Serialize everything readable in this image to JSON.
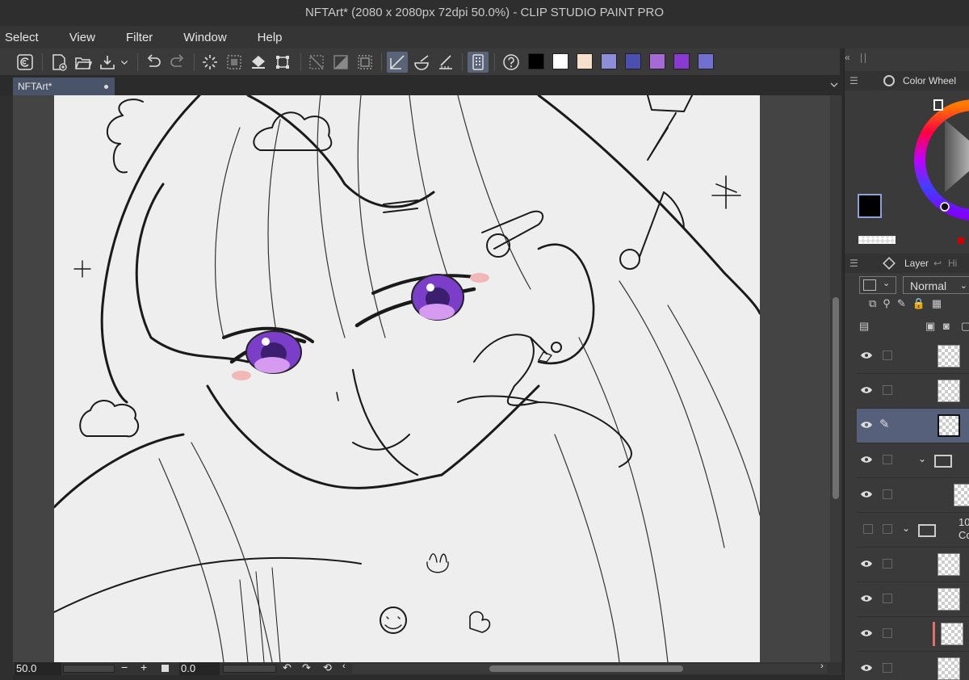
{
  "window": {
    "title": "NFTArt* (2080 x 2080px 72dpi 50.0%)  - CLIP STUDIO PAINT PRO"
  },
  "menu": [
    "Select",
    "View",
    "Filter",
    "Window",
    "Help"
  ],
  "document_tab": {
    "label": "NFTArt*"
  },
  "palette_colors": [
    "#000000",
    "#ffffff",
    "#f6e0cc",
    "#8c8fd8",
    "#4b4fb0",
    "#a66ad8",
    "#8a3ad0",
    "#7070d0"
  ],
  "color_panel": {
    "title": "Color Wheel",
    "main_color": "#000000",
    "sub_color": "#3c3a36"
  },
  "layer_panel": {
    "tab_label": "Layer",
    "tab2_label": "Hi",
    "blend_mode": "Normal",
    "group_label_1": "10",
    "group_label_2": "Co"
  },
  "status": {
    "zoom": "50.0",
    "rotation": "0.0"
  }
}
